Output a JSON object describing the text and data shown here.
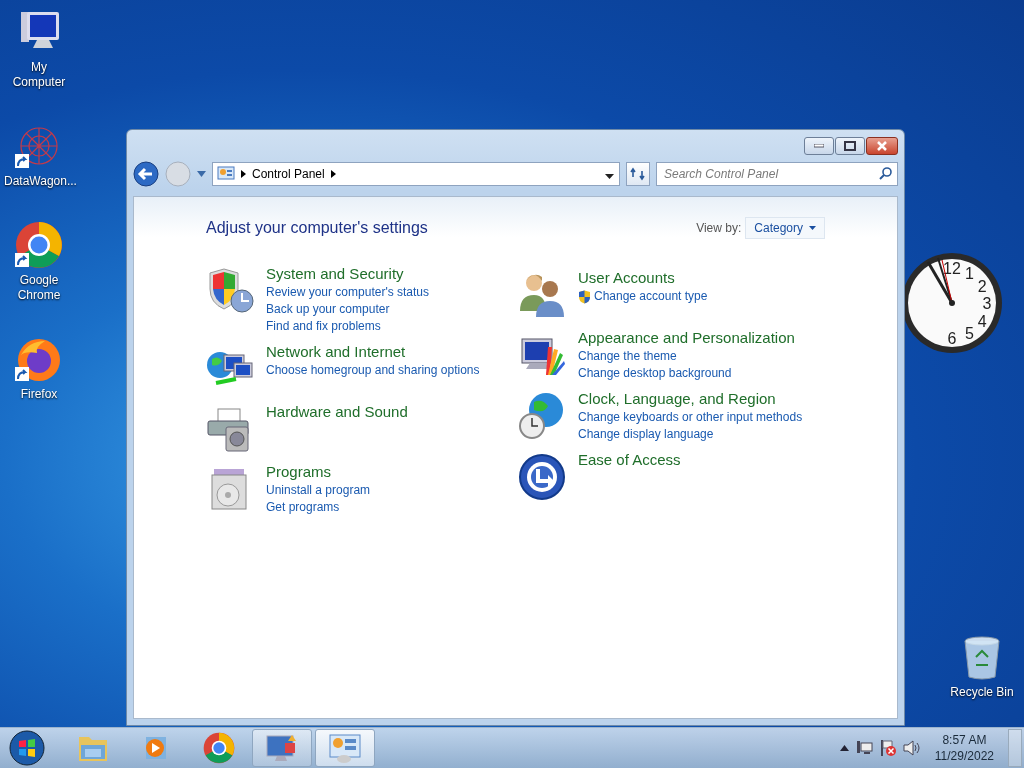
{
  "desktop_icons": [
    {
      "kind": "computer",
      "label": "My Computer",
      "shortcut": false
    },
    {
      "kind": "network-art",
      "label": "DataWagon...",
      "shortcut": true
    },
    {
      "kind": "chrome",
      "label": "Google Chrome",
      "shortcut": true
    },
    {
      "kind": "firefox",
      "label": "Firefox",
      "shortcut": true
    }
  ],
  "window": {
    "nav": [
      {
        "kind": "back",
        "disabled": false
      },
      {
        "kind": "forward",
        "disabled": true
      }
    ],
    "address": {
      "crumbs": [
        "Control Panel"
      ]
    },
    "search": {
      "placeholder": "Search Control Panel"
    },
    "heading": "Adjust your computer's settings",
    "view_by": {
      "label": "View by:",
      "value": "Category"
    },
    "columns": [
      [
        {
          "kind": "security",
          "title": "System and Security",
          "links": [
            {
              "text": "Review your computer's status",
              "shield": false
            },
            {
              "text": "Back up your computer",
              "shield": false
            },
            {
              "text": "Find and fix problems",
              "shield": false
            }
          ]
        },
        {
          "kind": "network",
          "title": "Network and Internet",
          "links": [
            {
              "text": "Choose homegroup and sharing options",
              "shield": false
            }
          ]
        },
        {
          "kind": "hardware",
          "title": "Hardware and Sound"
        },
        {
          "kind": "programs",
          "title": "Programs",
          "links": [
            {
              "text": "Uninstall a program",
              "shield": false
            },
            {
              "text": "Get programs",
              "shield": false
            }
          ]
        }
      ],
      [
        {
          "kind": "users",
          "title": "User Accounts",
          "links": [
            {
              "text": "Change account type",
              "shield": true
            }
          ]
        },
        {
          "kind": "appearance",
          "title": "Appearance and Personalization",
          "links": [
            {
              "text": "Change the theme",
              "shield": false
            },
            {
              "text": "Change desktop background",
              "shield": false
            }
          ]
        },
        {
          "kind": "clock",
          "title": "Clock, Language, and Region",
          "links": [
            {
              "text": "Change keyboards or other input methods",
              "shield": false
            },
            {
              "text": "Change display language",
              "shield": false
            }
          ]
        },
        {
          "kind": "ease",
          "title": "Ease of Access"
        }
      ]
    ]
  },
  "clock_gadget": {
    "numbers": [
      "12",
      "1",
      "2",
      "3",
      "4",
      "5",
      "6"
    ]
  },
  "recycle_bin": {
    "label": "Recycle Bin"
  },
  "taskbar": {
    "buttons": [
      {
        "kind": "explorer",
        "open": false,
        "selected": false
      },
      {
        "kind": "media",
        "open": false,
        "selected": false
      },
      {
        "kind": "chrome",
        "open": false,
        "selected": false
      },
      {
        "kind": "remote",
        "open": true,
        "selected": false
      },
      {
        "kind": "control-panel",
        "open": true,
        "selected": true
      }
    ],
    "time": "8:57 AM",
    "date": "11/29/2022"
  }
}
